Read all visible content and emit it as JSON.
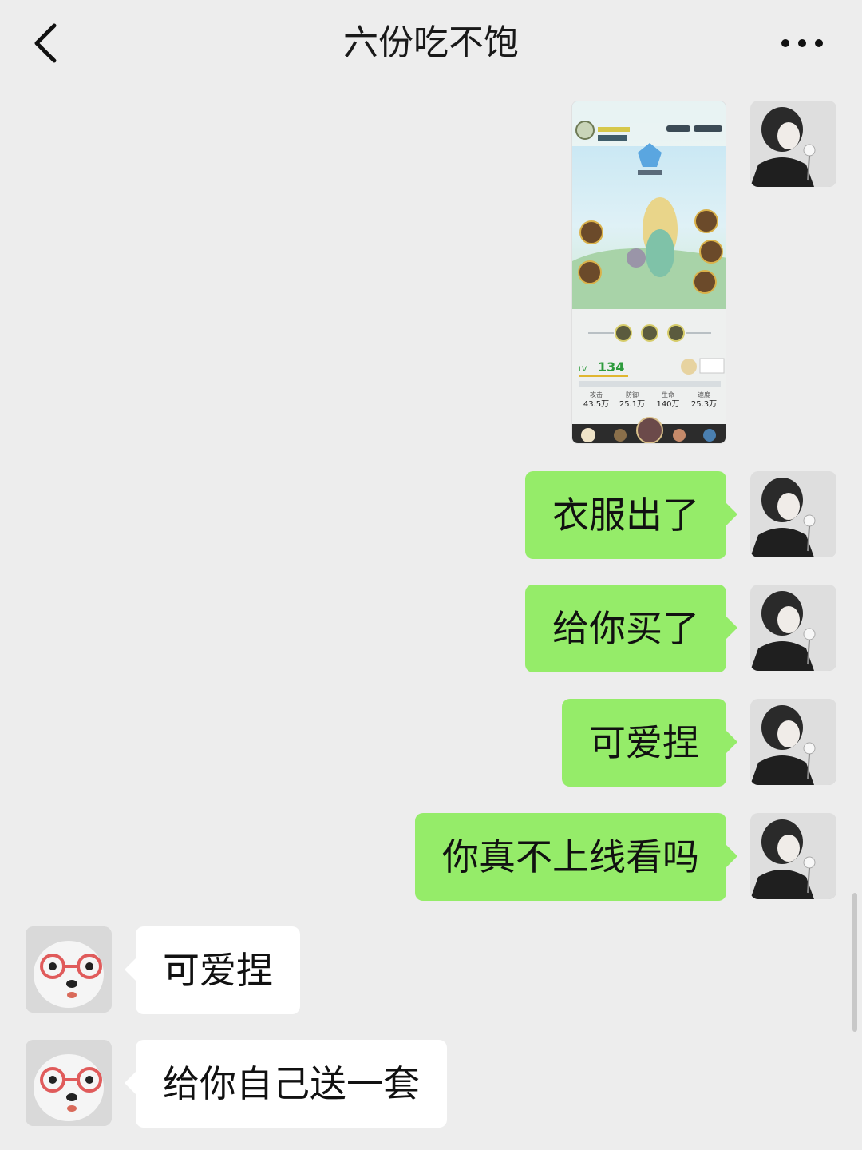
{
  "header": {
    "title": "六份吃不饱",
    "back_icon": "chevron-left-icon",
    "more_icon": "more-dots-icon"
  },
  "colors": {
    "background": "#ededed",
    "sent_bubble": "#95ec69",
    "received_bubble": "#ffffff"
  },
  "messages": [
    {
      "from": "me",
      "type": "image",
      "description_icon": "game-screenshot-image"
    },
    {
      "from": "me",
      "type": "text",
      "text": "衣服出了"
    },
    {
      "from": "me",
      "type": "text",
      "text": "给你买了"
    },
    {
      "from": "me",
      "type": "text",
      "text": "可爱捏"
    },
    {
      "from": "me",
      "type": "text",
      "text": "你真不上线看吗"
    },
    {
      "from": "other",
      "type": "text",
      "text": "可爱捏"
    },
    {
      "from": "other",
      "type": "text",
      "text": "给你自己送一套"
    }
  ],
  "shared_image": {
    "level_value": "134",
    "stats": [
      {
        "label": "攻击",
        "value": "43.5万"
      },
      {
        "label": "防御",
        "value": "25.1万"
      },
      {
        "label": "生命",
        "value": "140万"
      },
      {
        "label": "速度",
        "value": "25.3万"
      }
    ]
  }
}
